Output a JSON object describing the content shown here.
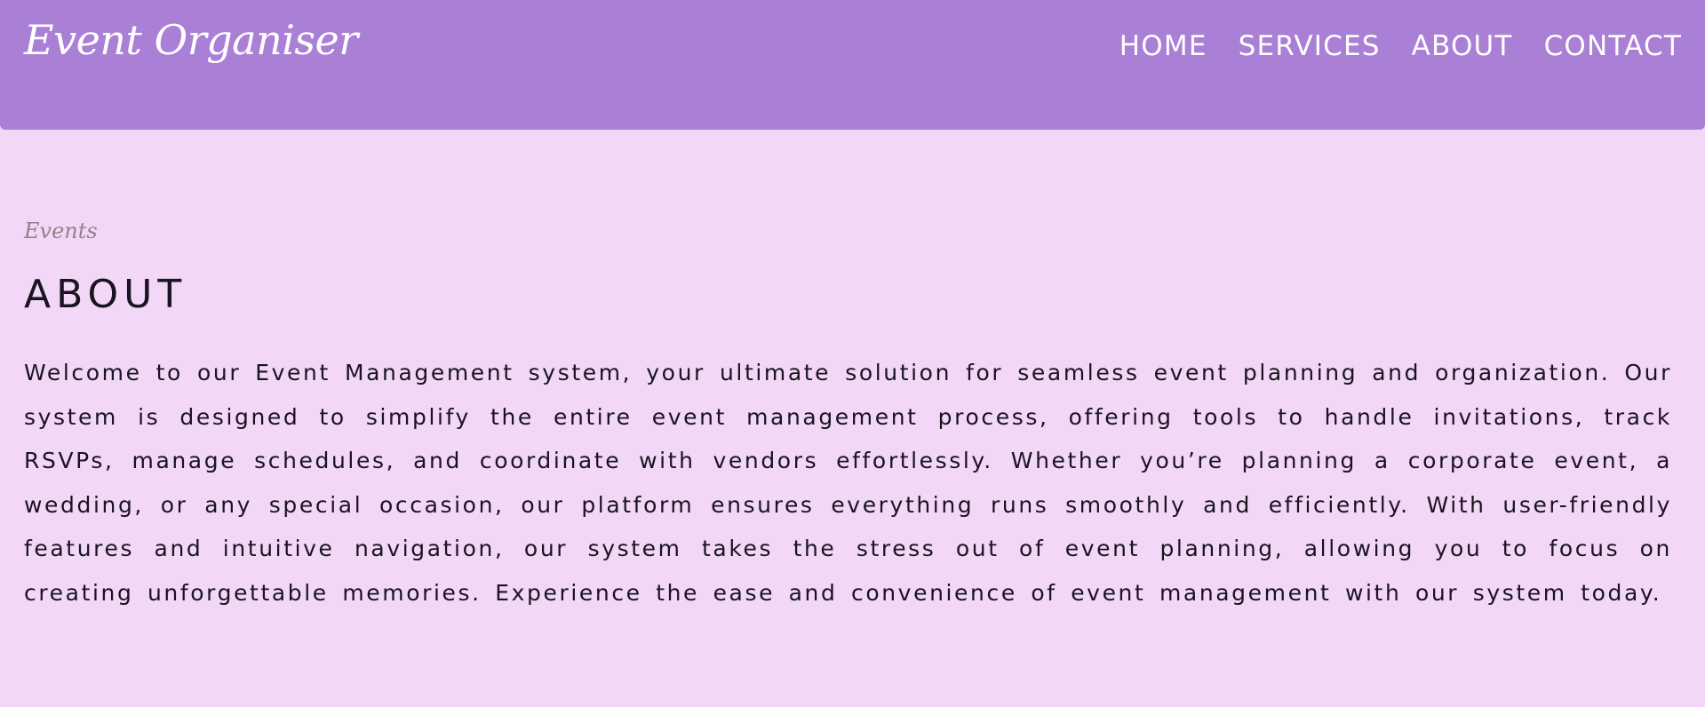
{
  "header": {
    "brand": "Event Organiser",
    "nav": [
      {
        "label": "HOME"
      },
      {
        "label": "SERVICES"
      },
      {
        "label": "ABOUT"
      },
      {
        "label": "CONTACT"
      }
    ]
  },
  "main": {
    "eyebrow": "Events",
    "title": "ABOUT",
    "paragraph": "Welcome to our Event Management system, your ultimate solution for seamless event planning and organization. Our system is designed to simplify the entire event management process, offering tools to handle invitations, track RSVPs, manage schedules, and coordinate with vendors effortlessly. Whether you’re planning a corporate event, a wedding, or any special occasion, our platform ensures everything runs smoothly and efficiently. With user-friendly features and intuitive navigation, our system takes the stress out of event planning, allowing you to focus on creating unforgettable memories. Experience the ease and convenience of event management with our system today."
  },
  "colors": {
    "header_bg": "#aa7fd6",
    "page_bg": "#f2d8f6",
    "eyebrow": "#9b7d8a",
    "text": "#1a1420"
  }
}
